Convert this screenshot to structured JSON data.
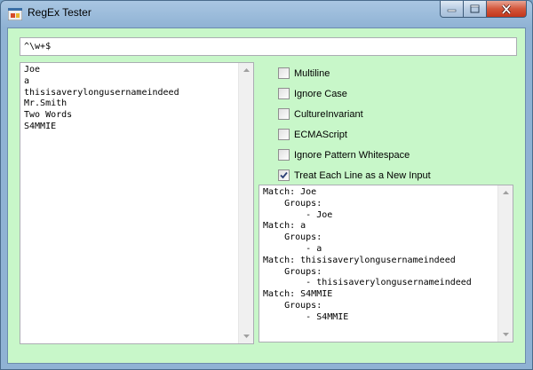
{
  "window": {
    "title": "RegEx Tester"
  },
  "pattern": {
    "value": "^\\w+$"
  },
  "input_text": {
    "lines": [
      "Joe",
      "a",
      "thisisaverylongusernameindeed",
      "Mr.Smith",
      "Two Words",
      "S4MMIE"
    ]
  },
  "options": [
    {
      "label": "Multiline",
      "checked": false
    },
    {
      "label": "Ignore Case",
      "checked": false
    },
    {
      "label": "CultureInvariant",
      "checked": false
    },
    {
      "label": "ECMAScript",
      "checked": false
    },
    {
      "label": "Ignore Pattern Whitespace",
      "checked": false
    },
    {
      "label": "Treat Each Line as a New Input",
      "checked": true
    }
  ],
  "output_text": {
    "lines": [
      "Match: Joe",
      "    Groups:",
      "        - Joe",
      "Match: a",
      "    Groups:",
      "        - a",
      "Match: thisisaverylongusernameindeed",
      "    Groups:",
      "        - thisisaverylongusernameindeed",
      "Match: S4MMIE",
      "    Groups:",
      "        - S4MMIE"
    ]
  }
}
